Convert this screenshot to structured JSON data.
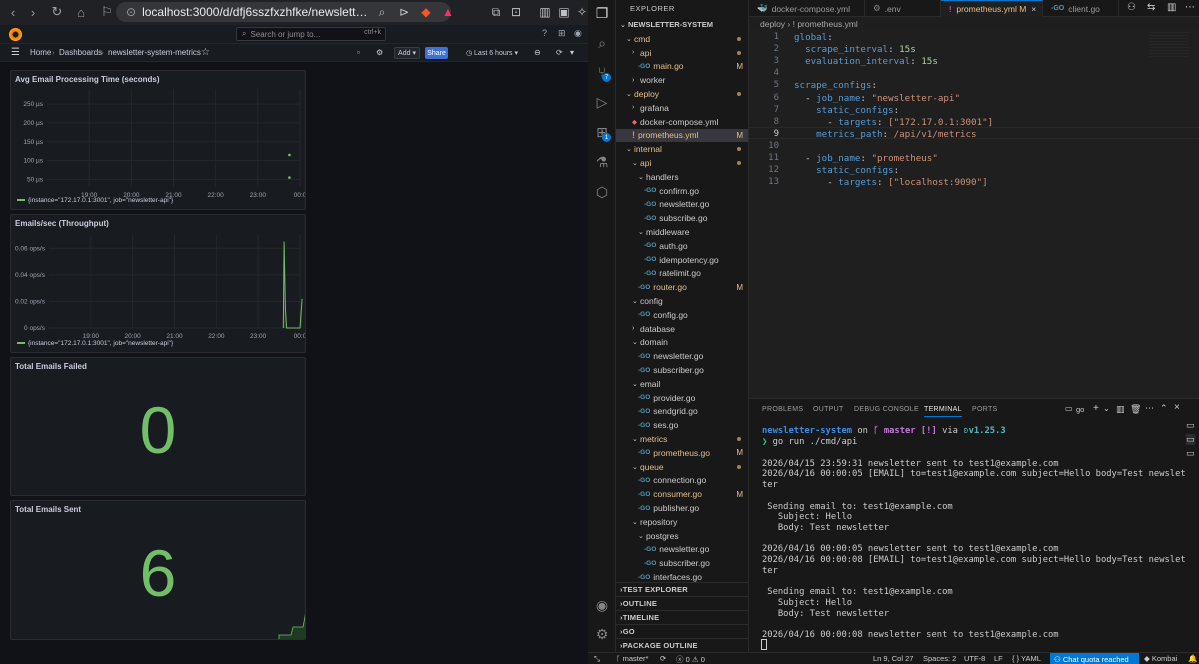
{
  "browser": {
    "url": "localhost:3000/d/dfj6sszfxzhfke/newsletter-system-m...",
    "search_placeholder": "Search or jump to...",
    "search_shortcut": "ctrl+k",
    "breadcrumbs": [
      "Home",
      "Dashboards",
      "newsletter-system-metrics"
    ],
    "add_label": "Add",
    "share_label": "Share",
    "time_range": "Last 6 hours"
  },
  "panels": [
    {
      "title": "Avg Email Processing Time (seconds)"
    },
    {
      "title": "Emails/sec (Throughput)"
    },
    {
      "title": "Total Emails Failed",
      "value": "0"
    },
    {
      "title": "Total Emails Sent",
      "value": "6"
    }
  ],
  "legend_label": "{instance=\"172.17.0.1:3001\", job=\"newsletter-api\"}",
  "chart_data": [
    {
      "type": "scatter",
      "title": "Avg Email Processing Time (seconds)",
      "y_ticks": [
        "250 µs",
        "200 µs",
        "150 µs",
        "100 µs",
        "50 µs"
      ],
      "x_ticks": [
        "19:00",
        "20:00",
        "21:00",
        "22:00",
        "23:00",
        "00:0"
      ],
      "ylim": [
        30,
        290
      ],
      "series": [
        {
          "name": "{instance=\"172.17.0.1:3001\", job=\"newsletter-api\"}",
          "x": [
            23.75,
            23.75
          ],
          "y": [
            115,
            55
          ]
        }
      ]
    },
    {
      "type": "line",
      "title": "Emails/sec (Throughput)",
      "y_ticks": [
        "0.06 ops/s",
        "0.04 ops/s",
        "0.02 ops/s",
        "0 ops/s"
      ],
      "x_ticks": [
        "19:00",
        "20:00",
        "21:00",
        "22:00",
        "23:00",
        "00:0"
      ],
      "ylim": [
        0,
        0.07
      ],
      "series": [
        {
          "name": "{instance=\"172.17.0.1:3001\", job=\"newsletter-api\"}",
          "x": [
            23.6,
            23.62,
            23.65,
            23.68,
            23.72,
            23.76,
            24.0,
            24.05
          ],
          "y": [
            0,
            0.065,
            0.015,
            0,
            0,
            0,
            0,
            0.022
          ]
        }
      ]
    }
  ],
  "vscode": {
    "explorer_title": "EXPLORER",
    "root": "NEWSLETTER-SYSTEM",
    "tree": [
      {
        "label": "cmd",
        "kind": "folder",
        "open": true,
        "level": 0,
        "dot": true
      },
      {
        "label": "api",
        "kind": "folder",
        "open": false,
        "level": 1,
        "dot": true
      },
      {
        "label": "main.go",
        "kind": "go",
        "level": 2,
        "m": "M"
      },
      {
        "label": "worker",
        "kind": "folder",
        "open": false,
        "level": 1
      },
      {
        "label": "deploy",
        "kind": "folder",
        "open": true,
        "level": 0,
        "dot": true
      },
      {
        "label": "grafana",
        "kind": "folder",
        "open": false,
        "level": 1
      },
      {
        "label": "docker-compose.yml",
        "kind": "docker",
        "level": 1
      },
      {
        "label": "prometheus.yml",
        "kind": "yaml",
        "level": 1,
        "m": "M",
        "selected": true
      },
      {
        "label": "internal",
        "kind": "folder",
        "open": true,
        "level": 0,
        "dot": true
      },
      {
        "label": "api",
        "kind": "folder",
        "open": true,
        "level": 1,
        "dot": true
      },
      {
        "label": "handlers",
        "kind": "folder",
        "open": true,
        "level": 2
      },
      {
        "label": "confirm.go",
        "kind": "go",
        "level": 3
      },
      {
        "label": "newsletter.go",
        "kind": "go",
        "level": 3
      },
      {
        "label": "subscribe.go",
        "kind": "go",
        "level": 3
      },
      {
        "label": "middleware",
        "kind": "folder",
        "open": true,
        "level": 2
      },
      {
        "label": "auth.go",
        "kind": "go",
        "level": 3
      },
      {
        "label": "idempotency.go",
        "kind": "go",
        "level": 3
      },
      {
        "label": "ratelimit.go",
        "kind": "go",
        "level": 3
      },
      {
        "label": "router.go",
        "kind": "go",
        "level": 2,
        "m": "M"
      },
      {
        "label": "config",
        "kind": "folder",
        "open": true,
        "level": 1
      },
      {
        "label": "config.go",
        "kind": "go",
        "level": 2
      },
      {
        "label": "database",
        "kind": "folder",
        "open": false,
        "level": 1
      },
      {
        "label": "domain",
        "kind": "folder",
        "open": true,
        "level": 1
      },
      {
        "label": "newsletter.go",
        "kind": "go",
        "level": 2
      },
      {
        "label": "subscriber.go",
        "kind": "go",
        "level": 2
      },
      {
        "label": "email",
        "kind": "folder",
        "open": true,
        "level": 1
      },
      {
        "label": "provider.go",
        "kind": "go",
        "level": 2
      },
      {
        "label": "sendgrid.go",
        "kind": "go",
        "level": 2
      },
      {
        "label": "ses.go",
        "kind": "go",
        "level": 2
      },
      {
        "label": "metrics",
        "kind": "folder",
        "open": true,
        "level": 1,
        "dot": true
      },
      {
        "label": "prometheus.go",
        "kind": "go",
        "level": 2,
        "m": "M"
      },
      {
        "label": "queue",
        "kind": "folder",
        "open": true,
        "level": 1,
        "dot": true
      },
      {
        "label": "connection.go",
        "kind": "go",
        "level": 2
      },
      {
        "label": "consumer.go",
        "kind": "go",
        "level": 2,
        "m": "M"
      },
      {
        "label": "publisher.go",
        "kind": "go",
        "level": 2
      },
      {
        "label": "repository",
        "kind": "folder",
        "open": true,
        "level": 1
      },
      {
        "label": "postgres",
        "kind": "folder",
        "open": true,
        "level": 2
      },
      {
        "label": "newsletter.go",
        "kind": "go",
        "level": 3
      },
      {
        "label": "subscriber.go",
        "kind": "go",
        "level": 3
      },
      {
        "label": "interfaces.go",
        "kind": "go",
        "level": 2
      }
    ],
    "sections": [
      "TEST EXPLORER",
      "OUTLINE",
      "TIMELINE",
      "GO",
      "PACKAGE OUTLINE"
    ],
    "tabs": [
      {
        "label": "docker-compose.yml",
        "active": false
      },
      {
        "label": ".env",
        "active": false
      },
      {
        "label": "prometheus.yml M",
        "active": true
      },
      {
        "label": "client.go",
        "active": false
      }
    ],
    "editor_breadcrumb": "deploy  ›  !  prometheus.yml",
    "code_lines": [
      "global:",
      "  scrape_interval: 15s",
      "  evaluation_interval: 15s",
      "",
      "scrape_configs:",
      "  - job_name: \"newsletter-api\"",
      "    static_configs:",
      "      - targets: [\"172.17.0.1:3001\"]",
      "    metrics_path: /api/v1/metrics",
      "",
      "  - job_name: \"prometheus\"",
      "    static_configs:",
      "      - targets: [\"localhost:9090\"]"
    ],
    "panel_tabs": [
      "PROBLEMS",
      "OUTPUT",
      "DEBUG CONSOLE",
      "TERMINAL",
      "PORTS"
    ],
    "terminal_shell": "go",
    "terminal_prompt": {
      "dir": "newsletter-system",
      "on": "on",
      "branch": "master [!]",
      "via": "via",
      "ver": "v1.25.3",
      "cmd": "go run ./cmd/api"
    },
    "terminal_lines": [
      "",
      "2026/04/15 23:59:31 newsletter sent to test1@example.com",
      "2026/04/16 00:00:05 [EMAIL] to=test1@example.com subject=Hello body=Test newslet",
      "ter",
      "",
      " Sending email to: test1@example.com",
      "   Subject: Hello",
      "   Body: Test newsletter",
      "",
      "2026/04/16 00:00:05 newsletter sent to test1@example.com",
      "2026/04/16 00:00:08 [EMAIL] to=test1@example.com subject=Hello body=Test newslet",
      "ter",
      "",
      " Sending email to: test1@example.com",
      "   Subject: Hello",
      "   Body: Test newsletter",
      "",
      "2026/04/16 00:00:08 newsletter sent to test1@example.com"
    ],
    "status": {
      "branch": "master*",
      "errors": "0",
      "warnings": "0",
      "position": "Ln 9, Col 27",
      "spaces": "Spaces: 2",
      "encoding": "UTF-8",
      "eol": "LF",
      "language": "YAML",
      "quota": "Chat quota reached",
      "user": "Kombai"
    }
  },
  "colors": {
    "accent": "#0078d4",
    "grafana_green": "#73bf69",
    "modified": "#e2c08d"
  }
}
